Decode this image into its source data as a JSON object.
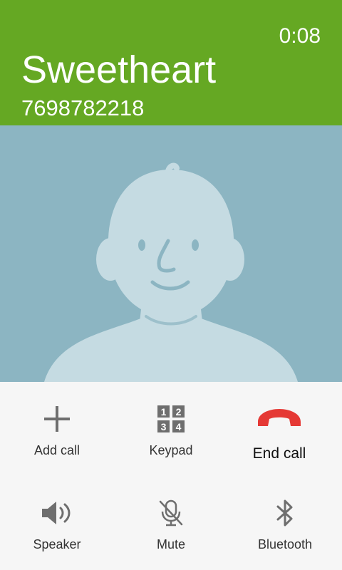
{
  "call": {
    "timer": "0:08",
    "contact_name": "Sweetheart",
    "phone_number": "7698782218"
  },
  "colors": {
    "header_bg": "#65a823",
    "photo_bg": "#8cb5c2",
    "avatar": "#c5dbe2",
    "end_call": "#e53935",
    "icon_gray": "#6e6e6e"
  },
  "controls": {
    "add_call": {
      "label": "Add call",
      "icon": "plus-icon"
    },
    "keypad": {
      "label": "Keypad",
      "icon": "keypad-icon",
      "digits": [
        "1",
        "2",
        "3",
        "4"
      ]
    },
    "end_call": {
      "label": "End call",
      "icon": "phone-hangup-icon"
    },
    "speaker": {
      "label": "Speaker",
      "icon": "speaker-icon"
    },
    "mute": {
      "label": "Mute",
      "icon": "mic-muted-icon"
    },
    "bluetooth": {
      "label": "Bluetooth",
      "icon": "bluetooth-icon"
    }
  }
}
